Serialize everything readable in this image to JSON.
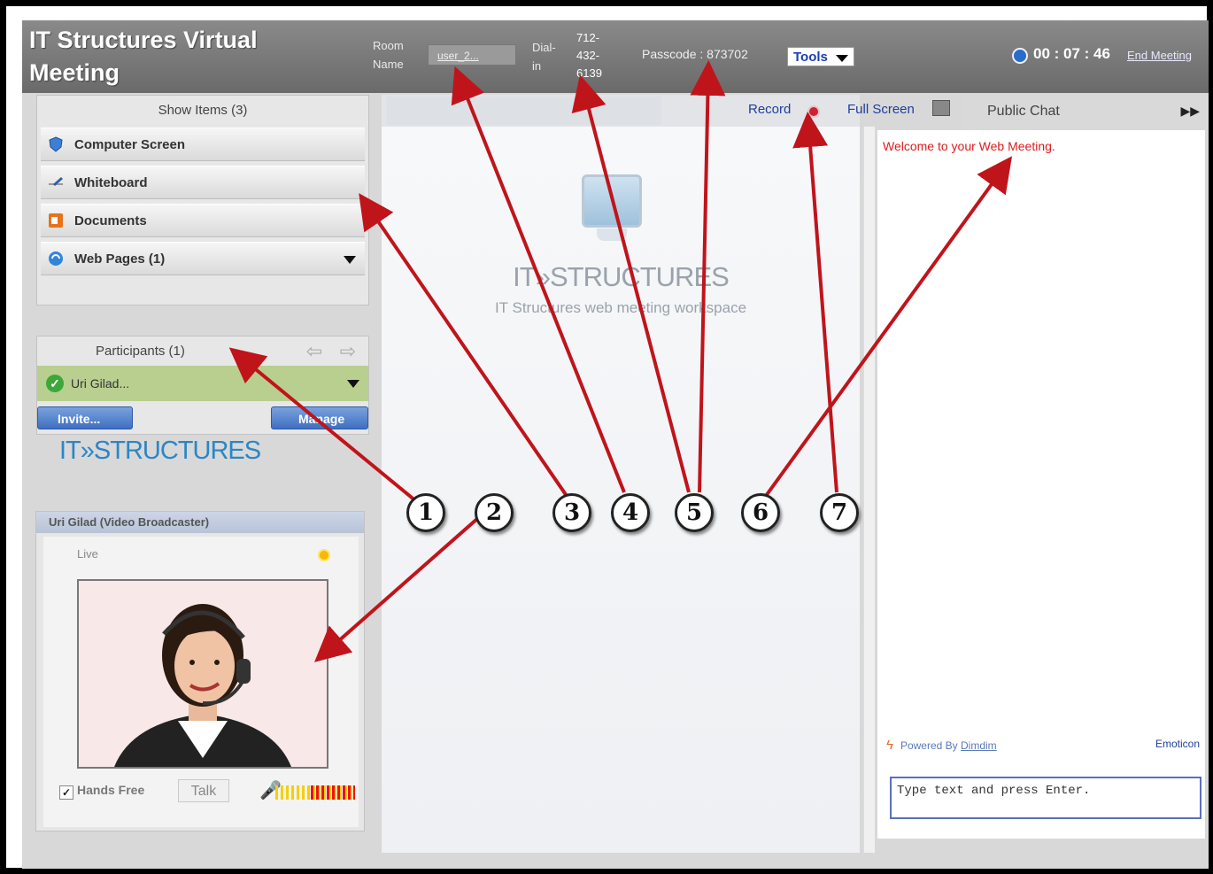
{
  "header": {
    "title": "IT Structures Virtual Meeting",
    "room_label": "Room Name",
    "room_value": "user_2...",
    "dial_label": "Dial-in",
    "dial_value": "712-432-6139",
    "passcode": "Passcode : 873702",
    "tools_label": "Tools",
    "timer": "00 : 07 : 46",
    "end_meeting": "End Meeting"
  },
  "show_items": {
    "title": "Show Items (3)",
    "items": [
      {
        "label": "Computer Screen",
        "icon": "monitor-icon"
      },
      {
        "label": "Whiteboard",
        "icon": "pen-icon"
      },
      {
        "label": "Documents",
        "icon": "document-icon"
      },
      {
        "label": "Web Pages (1)",
        "icon": "globe-icon"
      }
    ]
  },
  "participants": {
    "title": "Participants (1)",
    "list": [
      "Uri Gilad..."
    ],
    "invite_label": "Invite...",
    "manage_label": "Manage"
  },
  "brand": {
    "logo_text": "IT»STRUCTURES",
    "center_logo": "IT»STRUCTURES",
    "tagline": "IT Structures web meeting workspace"
  },
  "video": {
    "title": "Uri Gilad (Video Broadcaster)",
    "live_label": "Live",
    "hands_free_label": "Hands Free",
    "talk_label": "Talk"
  },
  "toolbar": {
    "record_label": "Record",
    "fullscreen_label": "Full Screen"
  },
  "chat": {
    "tab_label": "Public Chat",
    "welcome": "Welcome to your Web Meeting.",
    "powered_prefix": "Powered By",
    "powered_link": "Dimdim",
    "emoticon_label": "Emoticon",
    "input_placeholder": "Type text and press Enter."
  },
  "annotations": {
    "markers": [
      "1",
      "2",
      "3",
      "4",
      "5",
      "6",
      "7"
    ],
    "arrow_color": "#c0141b"
  },
  "colors": {
    "header_bg": "#777777",
    "accent_blue": "#1f3f9a",
    "chat_welcome": "#e01b1b",
    "participant_bg": "#b9cf8f"
  }
}
